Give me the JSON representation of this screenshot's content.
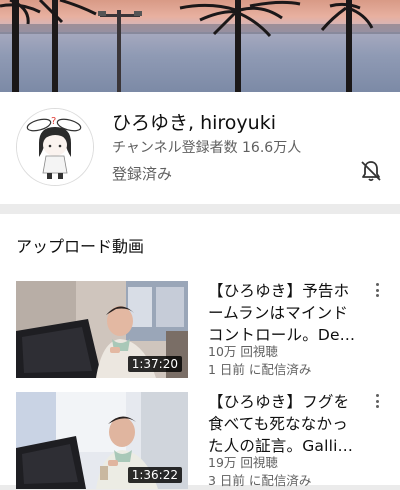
{
  "channel": {
    "name": "ひろゆき, hiroyuki",
    "subscribers": "チャンネル登録者数 16.6万人",
    "status": "登録済み",
    "bell_icon": "bell-off-icon",
    "avatar_icon": "bunny-ear-character-avatar"
  },
  "uploads": {
    "section_title": "アップロード動画",
    "videos": [
      {
        "title": "【ひろゆき】予告ホ\nームランはマインド\nコントロール。De...",
        "views": "10万 回視聴",
        "published": "1 日前 に配信済み",
        "duration": "1:37:20"
      },
      {
        "title": "【ひろゆき】フグを\n食べても死ななかっ\nた人の証言。Galli...",
        "views": "19万 回視聴",
        "published": "3 日前 に配信済み",
        "duration": "1:36:22"
      }
    ]
  },
  "colors": {
    "text_primary": "#0f0f0f",
    "text_secondary": "#606060",
    "background": "#ffffff",
    "separator": "#ebebeb"
  }
}
